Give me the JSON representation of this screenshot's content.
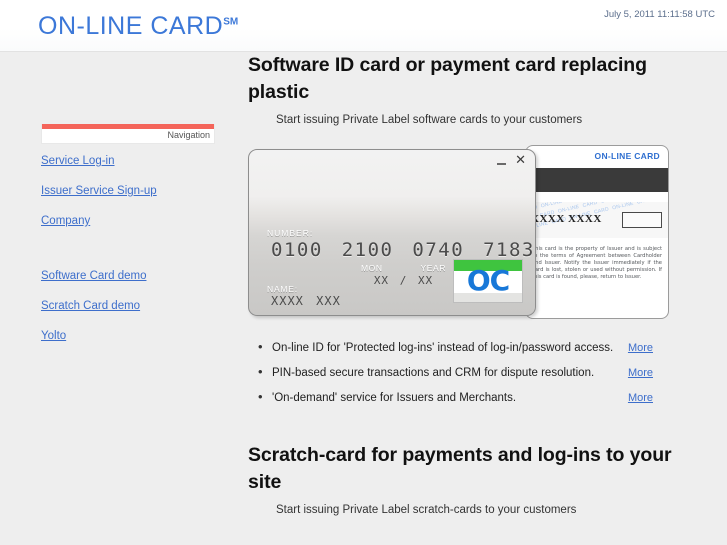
{
  "header": {
    "brand": "ON-LINE CARD",
    "brand_mark": "SM",
    "datetime": "July 5, 2011 11:11:58 UTC",
    "brand_color": "#3c78d8"
  },
  "sidebar": {
    "nav_label": "Navigation",
    "accent_color": "#f4645a",
    "items": [
      {
        "label": "Service Log-in"
      },
      {
        "label": "Issuer Service Sign-up"
      },
      {
        "label": "Company"
      },
      {
        "label": "Software Card demo"
      },
      {
        "label": "Scratch Card demo"
      },
      {
        "label": "Yolto"
      }
    ]
  },
  "main": {
    "section_one": {
      "title": "Software ID card or payment card replacing plastic",
      "subtitle": "Start issuing Private Label software cards to your customers",
      "bullets": [
        {
          "text": "On-line ID for 'Protected log-ins' instead of log-in/password access.",
          "more": "More"
        },
        {
          "text": "PIN-based secure transactions and CRM for dispute resolution.",
          "more": "More"
        },
        {
          "text": "'On-demand' service for Issuers and Merchants.",
          "more": "More"
        }
      ]
    },
    "section_two": {
      "title": "Scratch-card for payments and log-ins to your site",
      "subtitle": "Start issuing Private Label scratch-cards to your customers"
    }
  },
  "card_front": {
    "number_label": "NUMBER:",
    "number": "0100 2100 0740 7183",
    "month_label": "MON",
    "year_label": "YEAR",
    "month_value": "XX",
    "separator": "/",
    "year_value": "XX",
    "name_label": "NAME:",
    "name_value": "XXXX XXX",
    "minimize_icon": "minimize-icon",
    "close_icon": "close-icon",
    "logo_text": "OC",
    "logo_green": "#3fc43f",
    "logo_blue": "#1878d8"
  },
  "card_back": {
    "brand": "ON-LINE CARD",
    "signature_value": "XXXX XXXX",
    "watermark_text": "ON-LINE CARD ON-LINE CARD ON-LINE CARD ON-LINE CARD ON-LINE CARD ON-LINE CARD ON-LINE CARD ON-LINE CARD ON-LINE CARD ON-LINE CARD ON-LINE CARD ON-LINE CARD ON-LINE CARD ON-LINE CARD",
    "legal_text": "This card is the property of Issuer and is subject to the terms of Agreement between Cardholder and Issuer. Notify the Issuer immediately if the card is lost, stolen or used without permission. If this card is found, please, return to Issuer."
  }
}
